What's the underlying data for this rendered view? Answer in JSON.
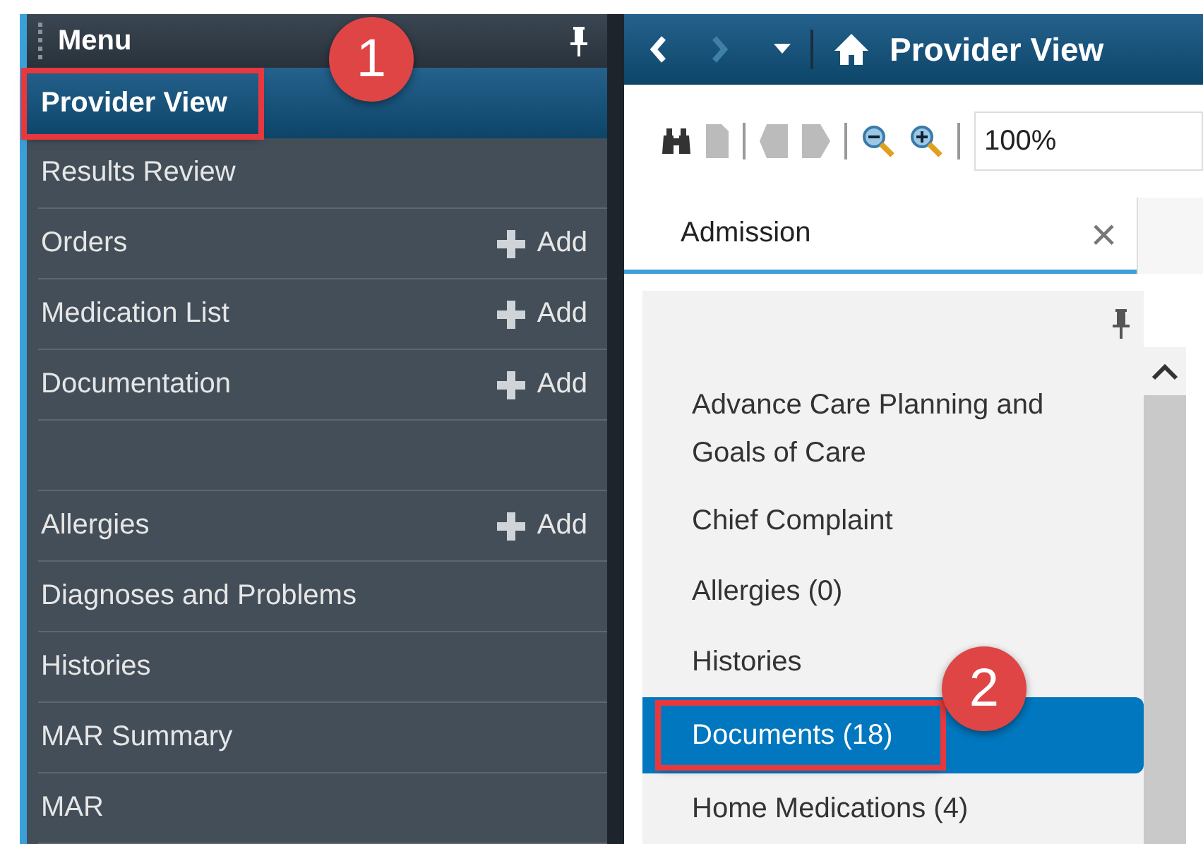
{
  "menu": {
    "title": "Menu",
    "items": [
      {
        "kind": "item",
        "label": "Provider View",
        "selected": true,
        "highlighted": true,
        "callout": "1"
      },
      {
        "kind": "item",
        "label": "Results Review",
        "selected": false
      },
      {
        "kind": "item",
        "label": "Orders",
        "selected": false,
        "add": "Add"
      },
      {
        "kind": "item",
        "label": "Medication List",
        "selected": false,
        "add": "Add"
      },
      {
        "kind": "item",
        "label": "Documentation",
        "selected": false,
        "add": "Add"
      },
      {
        "kind": "spacer"
      },
      {
        "kind": "item",
        "label": "Allergies",
        "selected": false,
        "add": "Add"
      },
      {
        "kind": "item",
        "label": "Diagnoses and Problems",
        "selected": false
      },
      {
        "kind": "item",
        "label": "Histories",
        "selected": false
      },
      {
        "kind": "item",
        "label": "MAR Summary",
        "selected": false
      },
      {
        "kind": "item",
        "label": "MAR",
        "selected": false
      }
    ]
  },
  "view": {
    "title": "Provider View",
    "zoom": "100%",
    "tabs": [
      {
        "label": "Admission",
        "selected": true,
        "close": "×"
      }
    ],
    "sections": [
      {
        "label": "Advance Care Planning and Goals of Care",
        "selected": false
      },
      {
        "label": "Chief Complaint",
        "selected": false
      },
      {
        "label": "Allergies (0)",
        "selected": false
      },
      {
        "label": "Histories",
        "selected": false
      },
      {
        "label": "Documents (18)",
        "selected": true,
        "highlighted": true,
        "callout": "2"
      },
      {
        "label": "Home Medications (4)",
        "selected": false
      }
    ]
  }
}
